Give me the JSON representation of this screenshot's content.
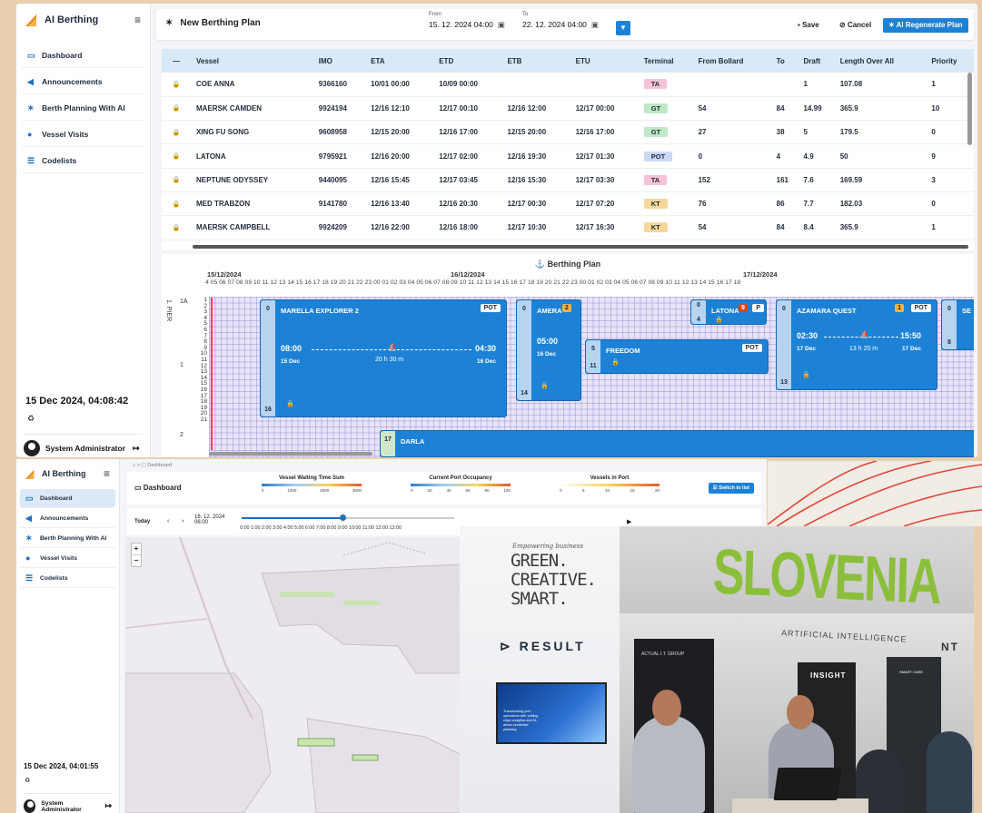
{
  "app": {
    "brand": "AI Berthing",
    "nav": [
      {
        "label": "Dashboard",
        "icon": "monitor-icon"
      },
      {
        "label": "Announcements",
        "icon": "megaphone-icon"
      },
      {
        "label": "Berth Planning With AI",
        "icon": "magic-wand-icon"
      },
      {
        "label": "Vessel Visits",
        "icon": "map-pin-icon"
      },
      {
        "label": "Codelists",
        "icon": "list-icon"
      }
    ],
    "user": "System Administrator"
  },
  "planner": {
    "clock": "15 Dec 2024, 04:08:42",
    "title": "New Berthing Plan",
    "from_label": "From",
    "from_value": "15. 12. 2024 04:00",
    "to_label": "To",
    "to_value": "22. 12. 2024 04:00",
    "save_label": "Save",
    "cancel_label": "Cancel",
    "ai_label": "AI Regenerate Plan",
    "table": {
      "first_header": "—",
      "headers": [
        "Vessel",
        "IMO",
        "ETA",
        "ETD",
        "ETB",
        "ETU",
        "Terminal",
        "From Bollard",
        "To",
        "Draft",
        "Length Over All",
        "Priority"
      ],
      "rows": [
        [
          "COE ANNA",
          "9366160",
          "10/01 00:00",
          "10/09 00:00",
          "",
          "",
          "TA",
          "",
          "",
          "1",
          "107.08",
          "1"
        ],
        [
          "MAERSK CAMDEN",
          "9924194",
          "12/16 12:10",
          "12/17 00:10",
          "12/16 12:00",
          "12/17 00:00",
          "GT",
          "54",
          "84",
          "14.99",
          "365.9",
          "10"
        ],
        [
          "XING FU SONG",
          "9608958",
          "12/15 20:00",
          "12/16 17:00",
          "12/15 20:00",
          "12/16 17:00",
          "GT",
          "27",
          "38",
          "5",
          "179.5",
          "0"
        ],
        [
          "LATONA",
          "9795921",
          "12/16 20:00",
          "12/17 02:00",
          "12/16 19:30",
          "12/17 01:30",
          "POT",
          "0",
          "4",
          "4.9",
          "50",
          "9"
        ],
        [
          "NEPTUNE ODYSSEY",
          "9440095",
          "12/16 15:45",
          "12/17 03:45",
          "12/16 15:30",
          "12/17 03:30",
          "TA",
          "152",
          "161",
          "7.6",
          "169.59",
          "3"
        ],
        [
          "MED TRABZON",
          "9141780",
          "12/16 13:40",
          "12/16 20:30",
          "12/17 00:30",
          "12/17 07:20",
          "KT",
          "76",
          "86",
          "7.7",
          "182.03",
          "0"
        ],
        [
          "MAERSK CAMPBELL",
          "9924209",
          "12/16 22:00",
          "12/16 18:00",
          "12/17 10:30",
          "12/17 16:30",
          "KT",
          "54",
          "84",
          "8.4",
          "365.9",
          "1"
        ]
      ],
      "terminal_colors": {
        "TA": "#f6c1d6",
        "GT": "#bfe8c6",
        "POT": "#c9d9f7",
        "KT": "#f6d79a"
      }
    },
    "plan": {
      "title": "Berthing Plan",
      "days": [
        "15/12/2024",
        "16/12/2024",
        "17/12/2024"
      ],
      "hours": "4 05 06 07 08 09 10 11 12 13 14 15 16 17 18 19 20 21 22 23 00 01 02 03 04 05 06 07 08 09 10 11 12 13 14 15 16 17 18 19 20 21 22 23 00 01 02 03 04 05 06 07 08 09 10 11 12 13 14 15 16 17 18",
      "pier_label": "1. PIER",
      "berth_labels": [
        "1A",
        "1",
        "2"
      ],
      "rows": "1 2 3 4 5 6 7 8 9 10 11 12 13 14 15 16 17 18 19 20 21",
      "vessels": [
        {
          "name": "MARELLA EXPLORER 2",
          "badge": "POT",
          "from": "0",
          "to": "16",
          "eta": "08:00",
          "eta_date": "15 Dec",
          "etd": "04:30",
          "etd_date": "16 Dec",
          "duration": "20 h 30 m"
        },
        {
          "name": "AMERA",
          "count": "2",
          "from": "0",
          "to": "14",
          "eta": "05:00",
          "eta_date": "16 Dec"
        },
        {
          "name": "FREEDOM",
          "badge": "POT",
          "from": "5",
          "to": "11"
        },
        {
          "name": "LATONA",
          "count": "9",
          "badge": "P",
          "from": "0",
          "to": "4"
        },
        {
          "name": "AZAMARA QUEST",
          "count": "1",
          "badge": "POT",
          "from": "0",
          "to": "13",
          "eta": "02:30",
          "eta_date": "17 Dec",
          "etd": "15:50",
          "etd_date": "17 Dec",
          "duration": "13 h 20 m"
        },
        {
          "name": "SE",
          "from": "0",
          "to": "8"
        },
        {
          "name": "DARLA",
          "from": "17"
        }
      ]
    }
  },
  "dashboard": {
    "breadcrumb": "⌂ > ▢ Dashboard",
    "clock": "15 Dec 2024, 04:01:55",
    "title": "Dashboard",
    "legends": [
      {
        "title": "Vessel Waiting Time Sum",
        "ticks": [
          "0",
          "1000",
          "2000",
          "3000"
        ]
      },
      {
        "title": "Current Port Occupancy",
        "ticks": [
          "0",
          "20",
          "40",
          "60",
          "80",
          "100"
        ]
      },
      {
        "title": "Vessels in Port",
        "ticks": [
          "0",
          "5",
          "10",
          "15",
          "20"
        ]
      }
    ],
    "switch_label": "Switch to list",
    "today_label": "Today",
    "current_date": "16. 12. 2024",
    "current_time": "06:00",
    "hours": "0:00 1:00 2:00 3:00 4:00 5:00 6:00 7:00 8:00 9:00 10:00 11:00 12:00 13:00"
  },
  "photo": {
    "emp": "Empowering business",
    "slogan": [
      "GREEN.",
      "CREATIVE.",
      "SMART."
    ],
    "result": "RESULT",
    "screen_text": "Transforming port operations with cutting-edge analytics and AI-driven predictive planning.",
    "country": "SLOVENIA",
    "tagline": "ARTIFICIAL INTELLIGENCE",
    "exhibitor1": "ACTUAL I.T. GROUP",
    "exhibitor2": "INSIGHT",
    "exhibitor3": "SMART CARE",
    "exhibitor4": "NT"
  }
}
